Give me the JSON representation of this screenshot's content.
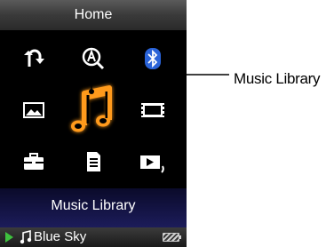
{
  "header": {
    "title": "Home"
  },
  "menu": {
    "items": [
      {
        "icon": "shuffle-all-icon"
      },
      {
        "icon": "intelligent-search-icon"
      },
      {
        "icon": "bluetooth-icon"
      },
      {
        "icon": "photo-icon"
      },
      {
        "icon": "music-note-icon",
        "selected": true
      },
      {
        "icon": "video-icon"
      },
      {
        "icon": "toolbox-icon"
      },
      {
        "icon": "podcast-icon"
      },
      {
        "icon": "now-playing-icon"
      }
    ],
    "selected_label": "Music Library"
  },
  "status": {
    "track_title": "Blue Sky",
    "state": "playing"
  },
  "annotation": {
    "label": "Music Library"
  },
  "colors": {
    "accent": "#ff9a1a",
    "bluetooth": "#2a63d8",
    "play": "#3ec13e",
    "label_band": "#1c1c5a"
  }
}
